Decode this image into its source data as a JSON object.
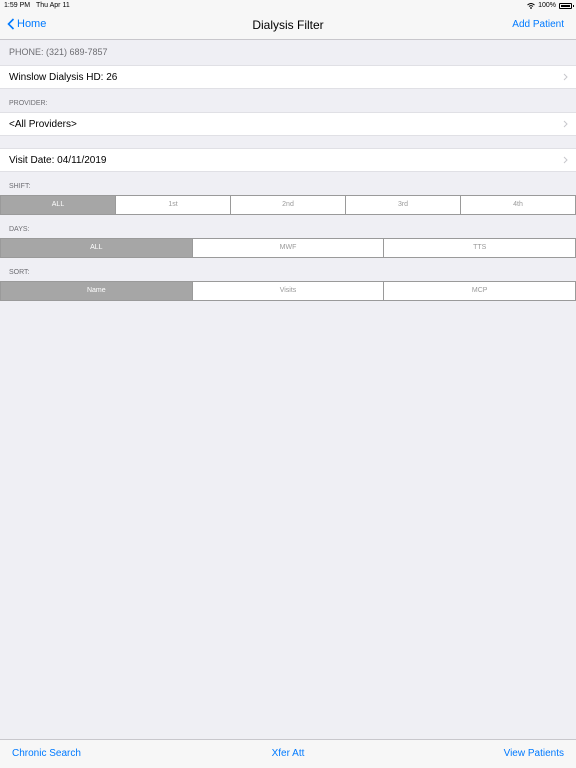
{
  "status": {
    "time": "1:59 PM",
    "date": "Thu Apr 11",
    "battery": "100%"
  },
  "nav": {
    "back": "Home",
    "title": "Dialysis Filter",
    "add": "Add Patient"
  },
  "phone": "PHONE: (321) 689-7857",
  "facility": "Winslow Dialysis HD: 26",
  "provider_label": "PROVIDER:",
  "provider": "<All Providers>",
  "visit_date": "Visit Date: 04/11/2019",
  "shift": {
    "label": "SHIFT:",
    "options": [
      "ALL",
      "1st",
      "2nd",
      "3rd",
      "4th"
    ],
    "selected": "ALL"
  },
  "days": {
    "label": "DAYS:",
    "options": [
      "ALL",
      "MWF",
      "TTS"
    ],
    "selected": "ALL"
  },
  "sort": {
    "label": "SORT:",
    "options": [
      "Name",
      "Visits",
      "MCP"
    ],
    "selected": "Name"
  },
  "toolbar": {
    "left": "Chronic Search",
    "center": "Xfer Att",
    "right": "View Patients"
  },
  "colors": {
    "accent": "#007aff",
    "selected_segment": "#a6a6a6"
  }
}
